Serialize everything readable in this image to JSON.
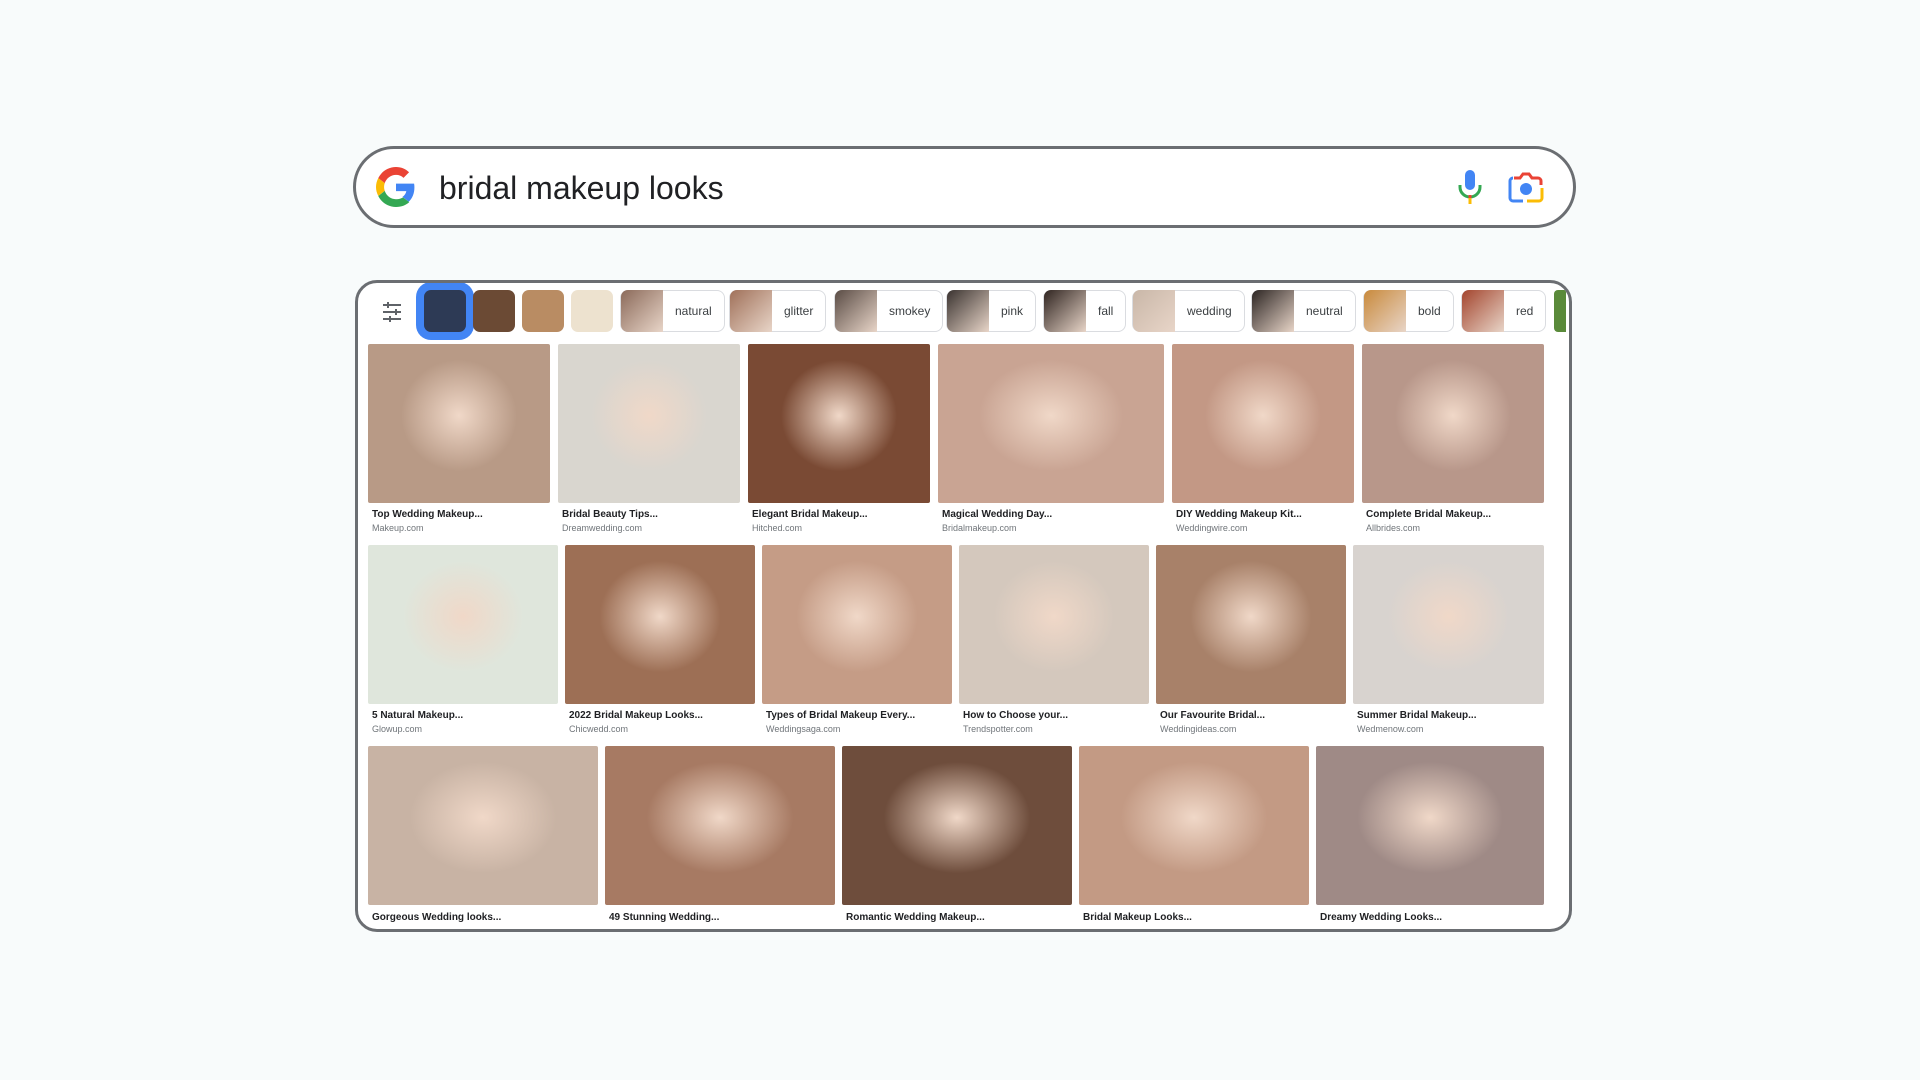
{
  "search": {
    "query": "bridal makeup looks",
    "icons": [
      "google-logo",
      "mic-icon",
      "camera-lens-icon"
    ]
  },
  "filters": {
    "icon": "tune-icon",
    "color_swatches": [
      {
        "color": "#2d3a55",
        "selected": true
      },
      {
        "color": "#6b4a34",
        "selected": false
      },
      {
        "color": "#b98c63",
        "selected": false
      },
      {
        "color": "#ede2cf",
        "selected": false
      }
    ],
    "chips": [
      {
        "label": "natural",
        "thumb_color": "#8b6a5a"
      },
      {
        "label": "glitter",
        "thumb_color": "#a0715a"
      },
      {
        "label": "smokey",
        "thumb_color": "#5a4c45"
      },
      {
        "label": "pink",
        "thumb_color": "#3a3330"
      },
      {
        "label": "fall",
        "thumb_color": "#2f2420"
      },
      {
        "label": "wedding",
        "thumb_color": "#c9b7a8"
      },
      {
        "label": "neutral",
        "thumb_color": "#2c2523"
      },
      {
        "label": "bold",
        "thumb_color": "#c98a3c"
      },
      {
        "label": "red",
        "thumb_color": "#a3452e"
      }
    ]
  },
  "results": {
    "row1": [
      {
        "title": "Top Wedding Makeup...",
        "source": "Makeup.com",
        "color": "#b89a86"
      },
      {
        "title": "Bridal Beauty Tips...",
        "source": "Dreamwedding.com",
        "color": "#d9d6cf"
      },
      {
        "title": "Elegant Bridal Makeup...",
        "source": "Hitched.com",
        "color": "#7a4a34"
      },
      {
        "title": "Magical Wedding Day...",
        "source": "Bridalmakeup.com",
        "color": "#c9a493"
      },
      {
        "title": "DIY Wedding Makeup Kit...",
        "source": "Weddingwire.com",
        "color": "#c39885"
      },
      {
        "title": "Complete Bridal Makeup...",
        "source": "Allbrides.com",
        "color": "#b8978a"
      }
    ],
    "row2": [
      {
        "title": "5 Natural Makeup...",
        "source": "Glowup.com",
        "color": "#dfe6dc"
      },
      {
        "title": "2022 Bridal Makeup Looks...",
        "source": "Chicwedd.com",
        "color": "#9d6f55"
      },
      {
        "title": "Types of Bridal Makeup Every...",
        "source": "Weddingsaga.com",
        "color": "#c59c86"
      },
      {
        "title": "How to Choose your...",
        "source": "Trendspotter.com",
        "color": "#d4c8bd"
      },
      {
        "title": "Our Favourite Bridal...",
        "source": "Weddingideas.com",
        "color": "#a88169"
      },
      {
        "title": "Summer Bridal Makeup...",
        "source": "Wedmenow.com",
        "color": "#d8d3cf"
      }
    ],
    "row3": [
      {
        "title": "Gorgeous Wedding looks...",
        "source": "",
        "color": "#c8b3a4"
      },
      {
        "title": "49 Stunning Wedding...",
        "source": "",
        "color": "#a77a63"
      },
      {
        "title": "Romantic Wedding Makeup...",
        "source": "",
        "color": "#6e4d3c"
      },
      {
        "title": "Bridal Makeup Looks...",
        "source": "",
        "color": "#c39a84"
      },
      {
        "title": "Dreamy Wedding Looks...",
        "source": "",
        "color": "#9f8a86"
      }
    ]
  }
}
